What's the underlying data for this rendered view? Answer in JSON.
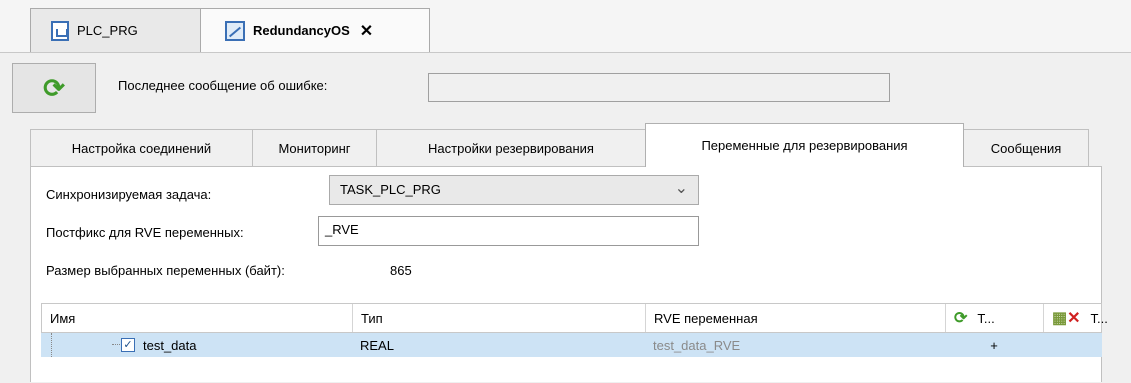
{
  "editor_tabs": [
    {
      "label": "PLC_PRG",
      "icon": "program-icon",
      "active": false
    },
    {
      "label": "RedundancyOS",
      "icon": "redundancy-icon",
      "active": true,
      "close": "✕"
    }
  ],
  "toolbar": {
    "refresh_icon": "refresh-icon",
    "last_error_label": "Последнее сообщение об ошибке:",
    "last_error_value": ""
  },
  "sub_tabs": [
    {
      "label": "Настройка соединений"
    },
    {
      "label": "Мониторинг"
    },
    {
      "label": "Настройки резервирования"
    },
    {
      "label": "Переменные для резервирования",
      "active": true
    },
    {
      "label": "Сообщения"
    }
  ],
  "form": {
    "sync_task_label": "Синхронизируемая задача:",
    "sync_task_value": "TASK_PLC_PRG",
    "postfix_label": "Постфикс для RVE переменных:",
    "postfix_value": "_RVE",
    "size_label": "Размер выбранных переменных (байт):",
    "size_value": "865"
  },
  "table": {
    "columns": [
      "Имя",
      "Тип",
      "RVE переменная",
      "Т...",
      "Т..."
    ],
    "rows": [
      {
        "name": "test_data",
        "type": "REAL",
        "rve": "test_data_RVE",
        "col4": "+",
        "col5": "",
        "checked": true
      }
    ]
  },
  "colors": {
    "accent_green": "#3f9b2a",
    "selection": "#cde3f5",
    "rve_text": "#8a8a8a"
  }
}
